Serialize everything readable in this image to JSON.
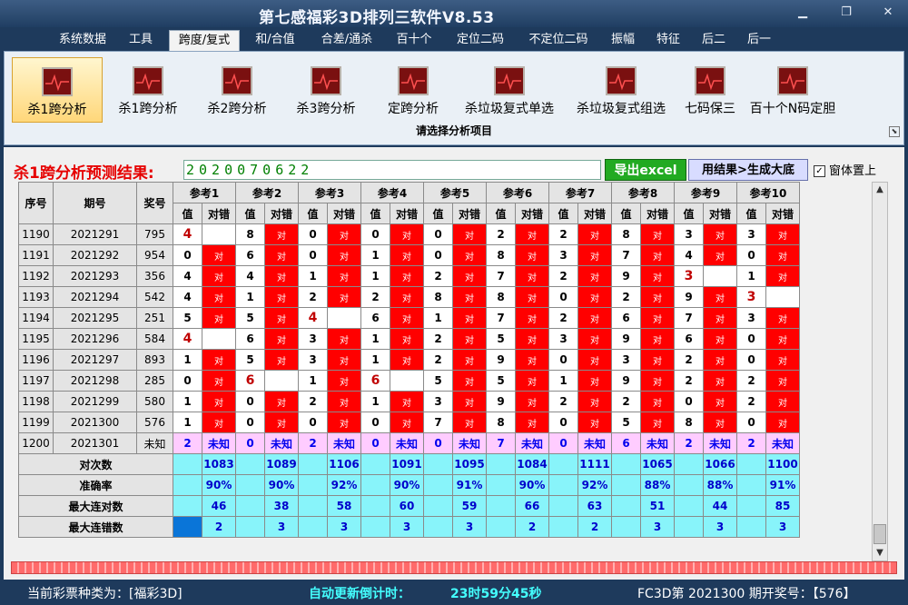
{
  "app": {
    "title": "第七感福彩3D排列三软件V8.53"
  },
  "menu": [
    "系统数据",
    "工具",
    "跨度/复式",
    "和/合值",
    "合差/通杀",
    "百十个",
    "定位二码",
    "不定位二码",
    "振幅",
    "特征",
    "后二",
    "后一"
  ],
  "ribbon": {
    "buttons": [
      "杀1跨分析",
      "杀1跨分析",
      "杀2跨分析",
      "杀3跨分析",
      "定跨分析",
      "杀垃圾复式单选",
      "杀垃圾复式组选",
      "七码保三",
      "百十个N码定胆"
    ],
    "group_label": "请选择分析项目"
  },
  "prediction": {
    "label": "杀1跨分析预测结果:",
    "value": "2020070622",
    "export_label": "导出excel",
    "generate_label": "用结果>生成大底",
    "topmost_label": "窗体置上",
    "topmost_checked": "✓"
  },
  "grid": {
    "headers": {
      "seq": "序号",
      "issue": "期号",
      "prize": "奖号",
      "val": "值",
      "mark": "对错"
    },
    "refs": [
      "参考1",
      "参考2",
      "参考3",
      "参考4",
      "参考5",
      "参考6",
      "参考7",
      "参考8",
      "参考9",
      "参考10"
    ],
    "rows": [
      {
        "seq": "1190",
        "issue": "2021291",
        "prize": "795",
        "cells": [
          [
            "4",
            0
          ],
          [
            "8",
            1
          ],
          [
            "0",
            1
          ],
          [
            "0",
            1
          ],
          [
            "0",
            1
          ],
          [
            "2",
            1
          ],
          [
            "2",
            1
          ],
          [
            "8",
            1
          ],
          [
            "3",
            1
          ],
          [
            "3",
            1
          ]
        ]
      },
      {
        "seq": "1191",
        "issue": "2021292",
        "prize": "954",
        "cells": [
          [
            "0",
            1
          ],
          [
            "6",
            1
          ],
          [
            "0",
            1
          ],
          [
            "1",
            1
          ],
          [
            "0",
            1
          ],
          [
            "8",
            1
          ],
          [
            "3",
            1
          ],
          [
            "7",
            1
          ],
          [
            "4",
            1
          ],
          [
            "0",
            1
          ]
        ]
      },
      {
        "seq": "1192",
        "issue": "2021293",
        "prize": "356",
        "cells": [
          [
            "4",
            1
          ],
          [
            "4",
            1
          ],
          [
            "1",
            1
          ],
          [
            "1",
            1
          ],
          [
            "2",
            1
          ],
          [
            "7",
            1
          ],
          [
            "2",
            1
          ],
          [
            "9",
            1
          ],
          [
            "3",
            0
          ],
          [
            "1",
            1
          ]
        ]
      },
      {
        "seq": "1193",
        "issue": "2021294",
        "prize": "542",
        "cells": [
          [
            "4",
            1
          ],
          [
            "1",
            1
          ],
          [
            "2",
            1
          ],
          [
            "2",
            1
          ],
          [
            "8",
            1
          ],
          [
            "8",
            1
          ],
          [
            "0",
            1
          ],
          [
            "2",
            1
          ],
          [
            "9",
            1
          ],
          [
            "3",
            0
          ]
        ]
      },
      {
        "seq": "1194",
        "issue": "2021295",
        "prize": "251",
        "cells": [
          [
            "5",
            1
          ],
          [
            "5",
            1
          ],
          [
            "4",
            0
          ],
          [
            "6",
            1
          ],
          [
            "1",
            1
          ],
          [
            "7",
            1
          ],
          [
            "2",
            1
          ],
          [
            "6",
            1
          ],
          [
            "7",
            1
          ],
          [
            "3",
            1
          ]
        ]
      },
      {
        "seq": "1195",
        "issue": "2021296",
        "prize": "584",
        "cells": [
          [
            "4",
            0
          ],
          [
            "6",
            1
          ],
          [
            "3",
            1
          ],
          [
            "1",
            1
          ],
          [
            "2",
            1
          ],
          [
            "5",
            1
          ],
          [
            "3",
            1
          ],
          [
            "9",
            1
          ],
          [
            "6",
            1
          ],
          [
            "0",
            1
          ]
        ]
      },
      {
        "seq": "1196",
        "issue": "2021297",
        "prize": "893",
        "cells": [
          [
            "1",
            1
          ],
          [
            "5",
            1
          ],
          [
            "3",
            1
          ],
          [
            "1",
            1
          ],
          [
            "2",
            1
          ],
          [
            "9",
            1
          ],
          [
            "0",
            1
          ],
          [
            "3",
            1
          ],
          [
            "2",
            1
          ],
          [
            "0",
            1
          ]
        ]
      },
      {
        "seq": "1197",
        "issue": "2021298",
        "prize": "285",
        "cells": [
          [
            "0",
            1
          ],
          [
            "6",
            0
          ],
          [
            "1",
            1
          ],
          [
            "6",
            0
          ],
          [
            "5",
            1
          ],
          [
            "5",
            1
          ],
          [
            "1",
            1
          ],
          [
            "9",
            1
          ],
          [
            "2",
            1
          ],
          [
            "2",
            1
          ]
        ]
      },
      {
        "seq": "1198",
        "issue": "2021299",
        "prize": "580",
        "cells": [
          [
            "1",
            1
          ],
          [
            "0",
            1
          ],
          [
            "2",
            1
          ],
          [
            "1",
            1
          ],
          [
            "3",
            1
          ],
          [
            "9",
            1
          ],
          [
            "2",
            1
          ],
          [
            "2",
            1
          ],
          [
            "0",
            1
          ],
          [
            "2",
            1
          ]
        ]
      },
      {
        "seq": "1199",
        "issue": "2021300",
        "prize": "576",
        "cells": [
          [
            "1",
            1
          ],
          [
            "0",
            1
          ],
          [
            "0",
            1
          ],
          [
            "0",
            1
          ],
          [
            "7",
            1
          ],
          [
            "8",
            1
          ],
          [
            "0",
            1
          ],
          [
            "5",
            1
          ],
          [
            "8",
            1
          ],
          [
            "0",
            1
          ]
        ]
      }
    ],
    "red_mark": "对",
    "total_row": {
      "seq": "1200",
      "issue": "2021301",
      "prize": "未知",
      "vals": [
        "2",
        "0",
        "2",
        "0",
        "0",
        "7",
        "0",
        "6",
        "2",
        "2"
      ],
      "unknown": "未知"
    },
    "stats": [
      {
        "label": "对次数",
        "vals": [
          "1083",
          "1089",
          "1106",
          "1091",
          "1095",
          "1084",
          "1111",
          "1065",
          "1066",
          "1100"
        ]
      },
      {
        "label": "准确率",
        "vals": [
          "90%",
          "90%",
          "92%",
          "90%",
          "91%",
          "90%",
          "92%",
          "88%",
          "88%",
          "91%"
        ]
      },
      {
        "label": "最大连对数",
        "vals": [
          "46",
          "38",
          "58",
          "60",
          "59",
          "66",
          "63",
          "51",
          "44",
          "85"
        ]
      },
      {
        "label": "最大连错数",
        "vals": [
          "2",
          "3",
          "3",
          "3",
          "3",
          "2",
          "2",
          "3",
          "3",
          "3"
        ]
      }
    ]
  },
  "status": {
    "lottery_type": "当前彩票种类为：[福彩3D]",
    "countdown_label": "自动更新倒计时：",
    "countdown": "23时59分45秒",
    "issue_info": "FC3D第  2021300  期开奖号：【576】"
  },
  "colors": {
    "accent": "#1e3a5c",
    "red": "#ff0000",
    "cyan": "#88f4fa",
    "pink": "#ffccff",
    "green": "#22aa22"
  }
}
